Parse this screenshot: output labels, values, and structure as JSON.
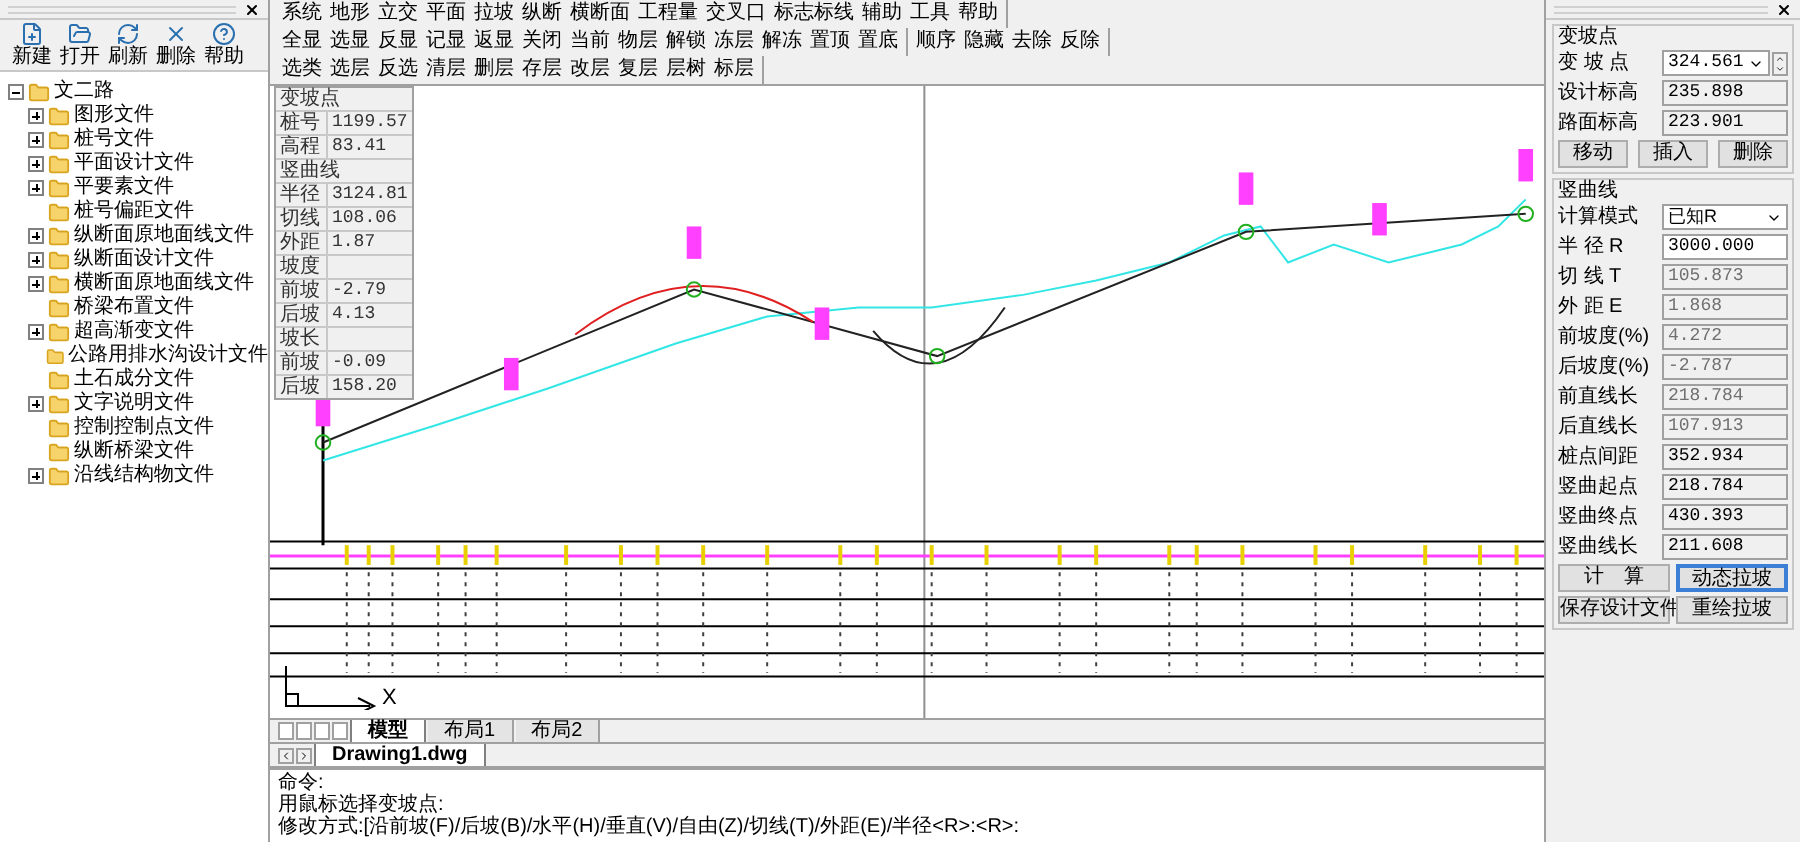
{
  "left_panel": {
    "tools": [
      {
        "label": "新建"
      },
      {
        "label": "打开"
      },
      {
        "label": "刷新"
      },
      {
        "label": "删除"
      },
      {
        "label": "帮助"
      }
    ],
    "tree": {
      "label": "文二路",
      "expanded": true,
      "children": [
        {
          "label": "图形文件",
          "expander": true
        },
        {
          "label": "桩号文件",
          "expander": true
        },
        {
          "label": "平面设计文件",
          "expander": true
        },
        {
          "label": "平要素文件",
          "expander": true
        },
        {
          "label": "桩号偏距文件",
          "expander": false
        },
        {
          "label": "纵断面原地面线文件",
          "expander": true
        },
        {
          "label": "纵断面设计文件",
          "expander": true
        },
        {
          "label": "横断面原地面线文件",
          "expander": true
        },
        {
          "label": "桥梁布置文件",
          "expander": false
        },
        {
          "label": "超高渐变文件",
          "expander": true
        },
        {
          "label": "公路用排水沟设计文件",
          "expander": false
        },
        {
          "label": "土石成分文件",
          "expander": false
        },
        {
          "label": "文字说明文件",
          "expander": true
        },
        {
          "label": "控制控制点文件",
          "expander": false
        },
        {
          "label": "纵断桥梁文件",
          "expander": false
        },
        {
          "label": "沿线结构物文件",
          "expander": true
        }
      ]
    }
  },
  "menu_groups": [
    [
      "系统",
      "地形",
      "立交",
      "平面",
      "拉坡",
      "纵断",
      "横断面",
      "工程量",
      "交叉口",
      "标志标线",
      "辅助",
      "工具",
      "帮助"
    ],
    [
      "全显",
      "选显",
      "反显",
      "记显",
      "返显",
      "关闭",
      "当前",
      "物层",
      "解锁",
      "冻层",
      "解冻",
      "置顶",
      "置底"
    ],
    [
      "顺序",
      "隐藏",
      "去除",
      "反除"
    ],
    [
      "选类",
      "选层",
      "反选",
      "清层",
      "删层",
      "存层",
      "改层",
      "复层",
      "层树",
      "标层"
    ]
  ],
  "info_box": {
    "title": "变坡点",
    "rows": [
      {
        "label": "桩号",
        "value": "1199.57"
      },
      {
        "label": "高程",
        "value": "83.41"
      },
      {
        "label": "竖曲线",
        "kind": "header"
      },
      {
        "label": "半径",
        "value": "3124.81"
      },
      {
        "label": "切线",
        "value": "108.06"
      },
      {
        "label": "外距",
        "value": "1.87"
      },
      {
        "label": "坡度"
      },
      {
        "label": "前坡",
        "value": "-2.79"
      },
      {
        "label": "后坡",
        "value": "4.13"
      },
      {
        "label": "坡长"
      },
      {
        "label": "前坡",
        "value": "-0.09"
      },
      {
        "label": "后坡",
        "value": "158.20"
      }
    ]
  },
  "canvas": {
    "ucs_label": "X"
  },
  "layout_tabs": [
    {
      "label": "模型",
      "selected": true
    },
    {
      "label": "布局1",
      "selected": false
    },
    {
      "label": "布局2",
      "selected": false
    }
  ],
  "file_tabs": [
    {
      "label": "Drawing1.dwg",
      "selected": true
    }
  ],
  "command_lines": [
    "命令:",
    "用鼠标选择变坡点:",
    "修改方式:[沿前坡(F)/后坡(B)/水平(H)/垂直(V)/自由(Z)/切线(T)/外距(E)/半径<R>:<R>:"
  ],
  "right_panel": {
    "sections": [
      {
        "title": "变坡点",
        "fields": [
          {
            "label": "变 坡 点",
            "value": "324.561",
            "kind": "spin"
          },
          {
            "label": "设计标高",
            "value": "235.898",
            "disabled": false
          },
          {
            "label": "路面标高",
            "value": "223.901",
            "disabled": false
          }
        ],
        "buttons": [
          {
            "label": "移动",
            "default": false
          },
          {
            "label": "插入",
            "default": false
          },
          {
            "label": "删除",
            "default": false
          }
        ]
      },
      {
        "title": "竖曲线",
        "fields": [
          {
            "label": "计算模式",
            "value": "已知R",
            "kind": "select"
          },
          {
            "label": "半 径 R",
            "value": "3000.000",
            "disabled": false,
            "white": true
          },
          {
            "label": "切 线 T",
            "value": "105.873",
            "disabled": true
          },
          {
            "label": "外 距 E",
            "value": "1.868",
            "disabled": true
          },
          {
            "label": "前坡度(%)",
            "value": "4.272",
            "disabled": true
          },
          {
            "label": "后坡度(%)",
            "value": "-2.787",
            "disabled": true
          },
          {
            "label": "前直线长",
            "value": "218.784",
            "disabled": true
          },
          {
            "label": "后直线长",
            "value": "107.913",
            "disabled": true
          },
          {
            "label": "桩点间距",
            "value": "352.934",
            "disabled": false
          },
          {
            "label": "竖曲起点",
            "value": "218.784",
            "disabled": false
          },
          {
            "label": "竖曲终点",
            "value": "430.393",
            "disabled": false
          },
          {
            "label": "竖曲线长",
            "value": "211.608",
            "disabled": false
          }
        ],
        "buttons": [
          {
            "label": "计　算",
            "default": false
          },
          {
            "label": "动态拉坡",
            "default": true
          },
          {
            "label": "保存设计文件",
            "default": false
          },
          {
            "label": "重绘拉坡",
            "default": false
          }
        ]
      }
    ]
  }
}
